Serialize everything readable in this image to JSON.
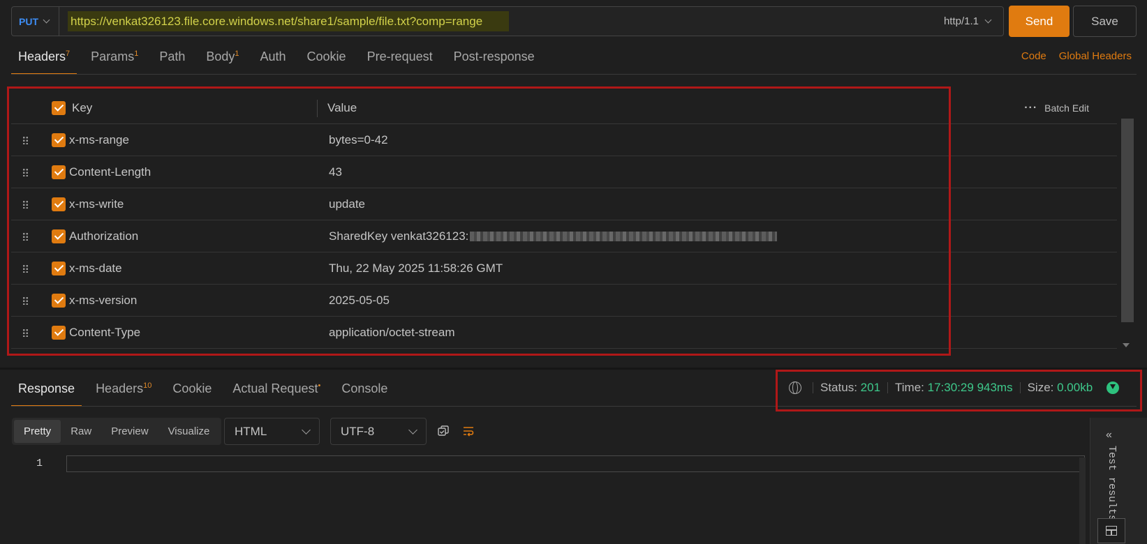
{
  "request": {
    "method": "PUT",
    "url": "https://venkat326123.file.core.windows.net/share1/sample/file.txt?comp=range",
    "protocol": "http/1.1",
    "send_label": "Send",
    "save_label": "Save"
  },
  "req_tabs": [
    {
      "label": "Headers",
      "badge": "7"
    },
    {
      "label": "Params",
      "badge": "1"
    },
    {
      "label": "Path",
      "badge": ""
    },
    {
      "label": "Body",
      "badge": "1"
    },
    {
      "label": "Auth",
      "badge": ""
    },
    {
      "label": "Cookie",
      "badge": ""
    },
    {
      "label": "Pre-request",
      "badge": ""
    },
    {
      "label": "Post-response",
      "badge": ""
    }
  ],
  "right_links": {
    "code": "Code",
    "global_headers": "Global Headers"
  },
  "headers_table": {
    "key_col": "Key",
    "value_col": "Value",
    "batch_edit": "Batch Edit",
    "rows": [
      {
        "key": "x-ms-range",
        "value": "bytes=0-42",
        "checked": true
      },
      {
        "key": "Content-Length",
        "value": "43",
        "checked": true
      },
      {
        "key": "x-ms-write",
        "value": "update",
        "checked": true
      },
      {
        "key": "Authorization",
        "value": "SharedKey venkat326123:",
        "checked": true,
        "redacted": true
      },
      {
        "key": "x-ms-date",
        "value": "Thu, 22 May 2025 11:58:26 GMT",
        "checked": true
      },
      {
        "key": "x-ms-version",
        "value": "2025-05-05",
        "checked": true
      },
      {
        "key": "Content-Type",
        "value": "application/octet-stream",
        "checked": true
      }
    ]
  },
  "resp_tabs": [
    {
      "label": "Response",
      "badge": ""
    },
    {
      "label": "Headers",
      "badge": "10"
    },
    {
      "label": "Cookie",
      "badge": ""
    },
    {
      "label": "Actual Request",
      "badge": "•"
    },
    {
      "label": "Console",
      "badge": ""
    }
  ],
  "status_bar": {
    "status_label": "Status:",
    "status_value": "201",
    "time_label": "Time:",
    "time_value": "17:30:29",
    "duration": "943ms",
    "size_label": "Size:",
    "size_value": "0.00kb"
  },
  "view_modes": [
    "Pretty",
    "Raw",
    "Preview",
    "Visualize"
  ],
  "format_select": "HTML",
  "encoding_select": "UTF-8",
  "editor": {
    "line_number": "1"
  },
  "test_panel": {
    "label": "Test results"
  },
  "colors": {
    "accent": "#e07b10",
    "success": "#3ec98b",
    "method": "#3d8df5"
  }
}
